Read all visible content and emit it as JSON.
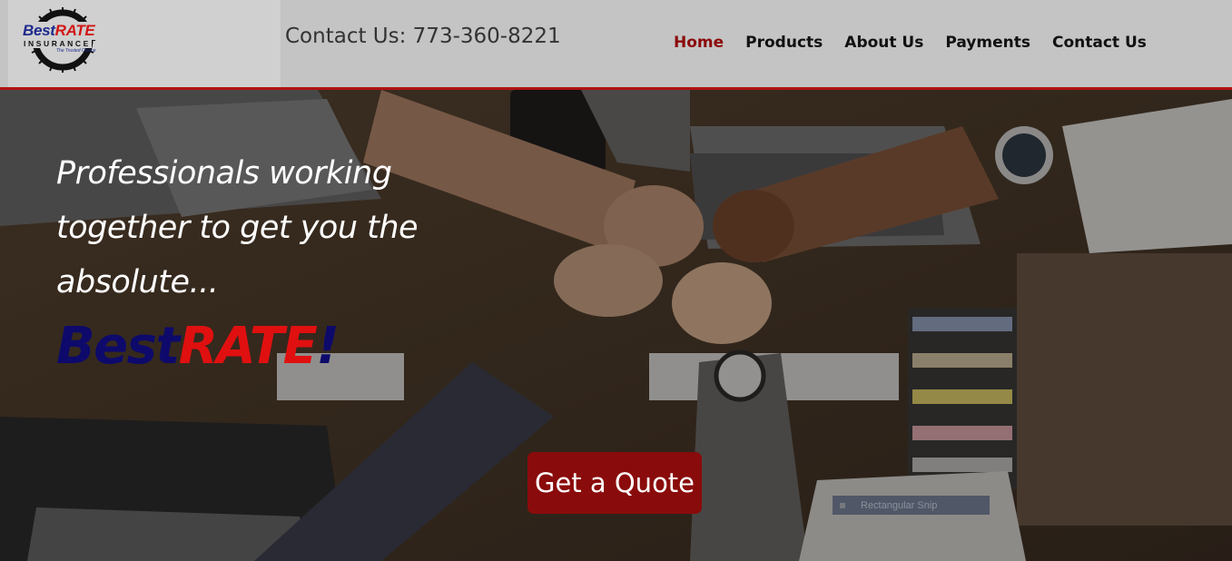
{
  "header": {
    "logo": {
      "brand_best": "Best",
      "brand_rate": "RATE",
      "insurance": "INSURANCE",
      "tagline": "The Trusted Choice"
    },
    "contact_line": "Contact Us: 773-360-8221",
    "nav": [
      {
        "label": "Home",
        "active": true
      },
      {
        "label": "Products",
        "active": false
      },
      {
        "label": "About Us",
        "active": false
      },
      {
        "label": "Payments",
        "active": false
      },
      {
        "label": "Contact Us",
        "active": false
      }
    ]
  },
  "hero": {
    "tagline": "Professionals working together to get you the absolute...",
    "brand": {
      "part1": "Best",
      "part2": "RATE",
      "part3": "!"
    },
    "cta_label": "Get a Quote",
    "snip_overlay_label": "Rectangular Snip"
  },
  "colors": {
    "header_bg": "#c4c4c4",
    "header_border": "#b01212",
    "nav_active": "#8b0a0a",
    "brand_blue": "#0d0a6b",
    "brand_red": "#e01010",
    "cta_bg": "#8a0b0b"
  }
}
